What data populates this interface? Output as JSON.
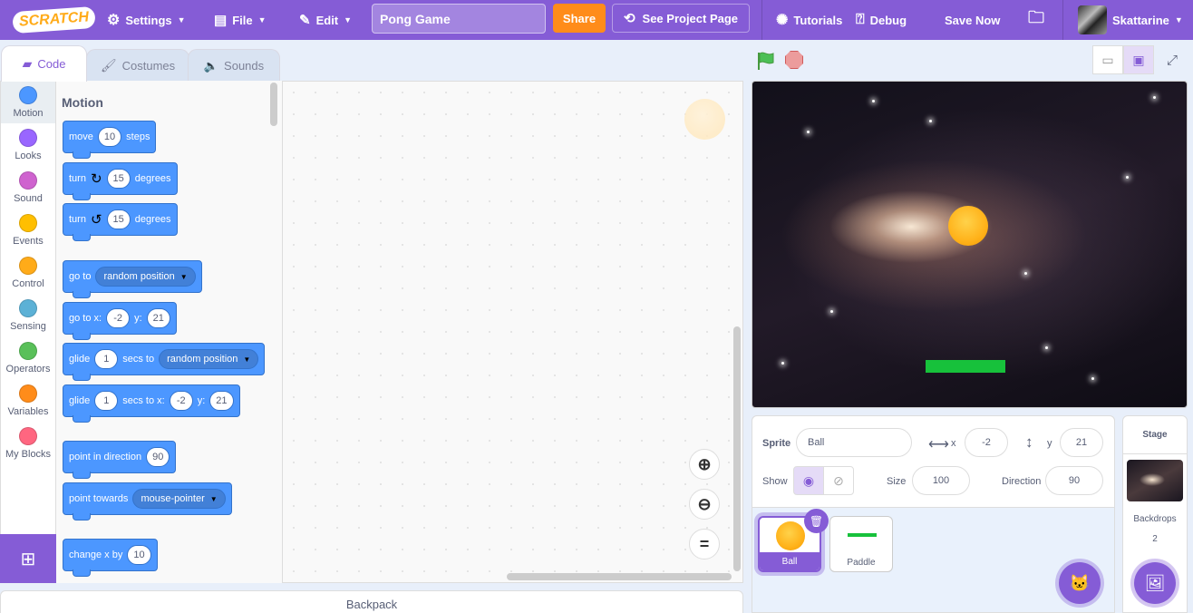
{
  "menu": {
    "logo": "SCRATCH",
    "settings": "Settings",
    "file": "File",
    "edit": "Edit",
    "project_title": "Pong Game",
    "share": "Share",
    "see_project": "See Project Page",
    "tutorials": "Tutorials",
    "debug": "Debug",
    "save_now": "Save Now",
    "username": "Skattarine"
  },
  "tabs": {
    "code": "Code",
    "costumes": "Costumes",
    "sounds": "Sounds"
  },
  "categories": [
    {
      "label": "Motion",
      "color": "#4c97ff"
    },
    {
      "label": "Looks",
      "color": "#9966ff"
    },
    {
      "label": "Sound",
      "color": "#cf63cf"
    },
    {
      "label": "Events",
      "color": "#ffbf00"
    },
    {
      "label": "Control",
      "color": "#ffab19"
    },
    {
      "label": "Sensing",
      "color": "#5cb1d6"
    },
    {
      "label": "Operators",
      "color": "#59c059"
    },
    {
      "label": "Variables",
      "color": "#ff8c1a"
    },
    {
      "label": "My Blocks",
      "color": "#ff6680"
    }
  ],
  "palette": {
    "heading": "Motion",
    "move": {
      "a": "move",
      "v": "10",
      "b": "steps"
    },
    "turn_right": {
      "a": "turn",
      "v": "15",
      "b": "degrees"
    },
    "turn_left": {
      "a": "turn",
      "v": "15",
      "b": "degrees"
    },
    "goto": {
      "a": "go to",
      "opt": "random position"
    },
    "goto_xy": {
      "a": "go to x:",
      "x": "-2",
      "b": "y:",
      "y": "21"
    },
    "glide": {
      "a": "glide",
      "v": "1",
      "b": "secs to",
      "opt": "random position"
    },
    "glide_xy": {
      "a": "glide",
      "v": "1",
      "b": "secs to x:",
      "x": "-2",
      "c": "y:",
      "y": "21"
    },
    "point_dir": {
      "a": "point in direction",
      "v": "90"
    },
    "point_towards": {
      "a": "point towards",
      "opt": "mouse-pointer"
    },
    "change_x": {
      "a": "change x by",
      "v": "10"
    }
  },
  "workspace": {
    "zoom_reset": "="
  },
  "backpack": "Backpack",
  "sprite_info": {
    "sprite_label": "Sprite",
    "sprite_name": "Ball",
    "x_label": "x",
    "x": "-2",
    "y_label": "y",
    "y": "21",
    "show_label": "Show",
    "size_label": "Size",
    "size": "100",
    "direction_label": "Direction",
    "direction": "90"
  },
  "sprites": [
    {
      "name": "Ball",
      "selected": true
    },
    {
      "name": "Paddle",
      "selected": false
    }
  ],
  "stage_panel": {
    "title": "Stage",
    "backdrops_label": "Backdrops",
    "backdrops_count": "2"
  },
  "colors": {
    "accent": "#855cd6",
    "motion": "#4c97ff",
    "share": "#ff8c1a"
  }
}
